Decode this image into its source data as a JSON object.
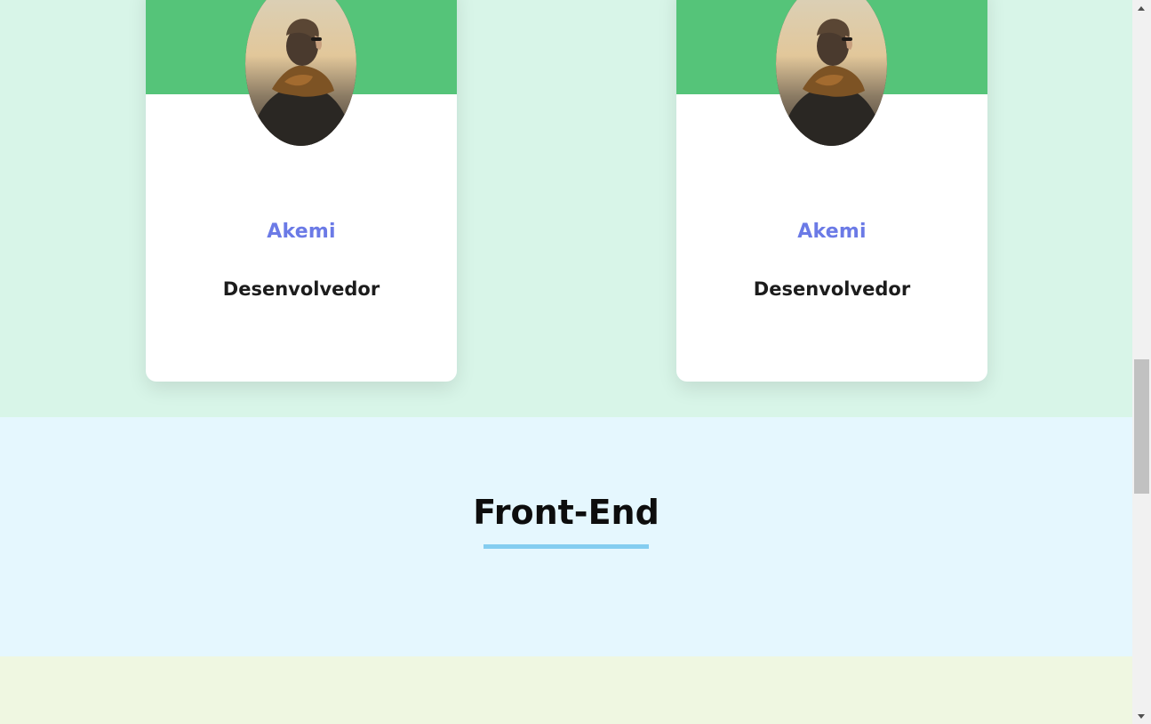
{
  "team": {
    "cards": [
      {
        "name": "Akemi",
        "role": "Desenvolvedor",
        "photo_icon": "person-photo-icon"
      },
      {
        "name": "Akemi",
        "role": "Desenvolvedor",
        "photo_icon": "person-photo-icon"
      }
    ],
    "colors": {
      "section_bg": "#d8f5e8",
      "card_banner": "#55c479",
      "name": "#6b7ae6",
      "role": "#1c1c1c"
    }
  },
  "frontend": {
    "title": "Front-End",
    "colors": {
      "section_bg": "#e5f7fe",
      "underline": "#84cdf0"
    }
  },
  "next_section": {
    "colors": {
      "section_bg": "#eff7e1"
    }
  },
  "scrollbar": {
    "scroll_position_fraction": 0.5
  }
}
